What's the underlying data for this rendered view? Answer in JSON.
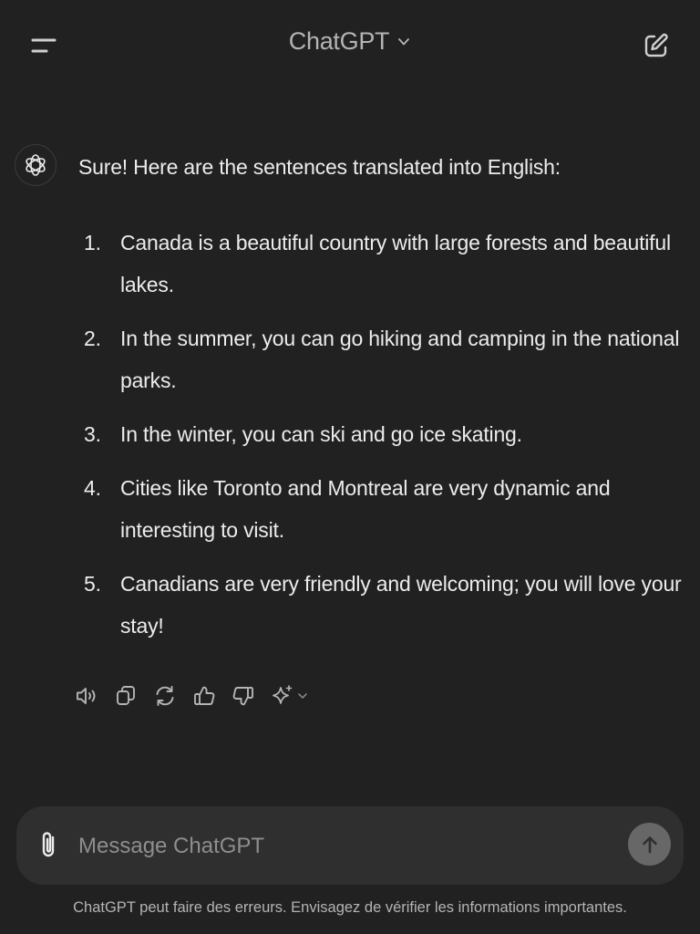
{
  "header": {
    "title": "ChatGPT",
    "menu_icon": "menu-icon",
    "new_chat_icon": "edit-icon"
  },
  "message": {
    "intro": "Sure! Here are the sentences translated into English:",
    "items": [
      {
        "num": "1.",
        "text": "Canada is a beautiful country with large forests and beautiful lakes."
      },
      {
        "num": "2.",
        "text": "In the summer, you can go hiking and camping in the national parks."
      },
      {
        "num": "3.",
        "text": "In the winter, you can ski and go ice skating."
      },
      {
        "num": "4.",
        "text": "Cities like Toronto and Montreal are very dynamic and interesting to visit."
      },
      {
        "num": "5.",
        "text": "Canadians are very friendly and welcoming; you will love your stay!"
      }
    ]
  },
  "actions": [
    "read-aloud-icon",
    "copy-icon",
    "regenerate-icon",
    "thumbs-up-icon",
    "thumbs-down-icon",
    "sparkle-icon"
  ],
  "composer": {
    "placeholder": "Message ChatGPT"
  },
  "footer": {
    "disclaimer": "ChatGPT peut faire des erreurs. Envisagez de vérifier les informations importantes."
  },
  "colors": {
    "background": "#212121",
    "composer": "#2f2f2f",
    "send_button": "#676767",
    "text": "#ececec",
    "muted": "#b4b4b4"
  }
}
